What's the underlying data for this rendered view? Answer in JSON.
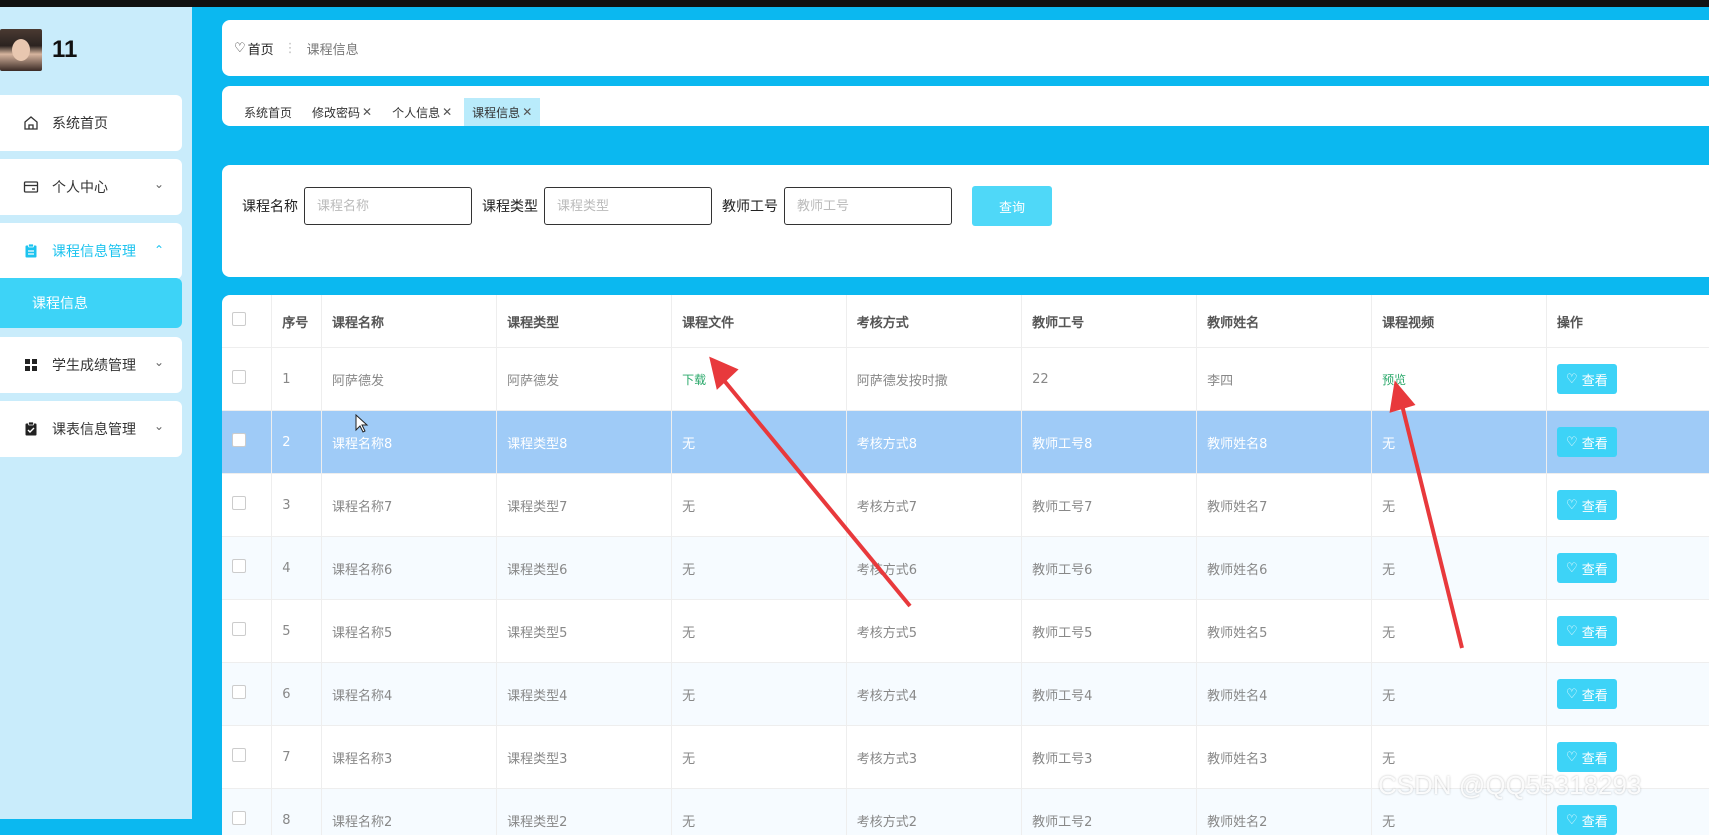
{
  "user": {
    "name": "11"
  },
  "sidebar": {
    "items": [
      {
        "label": "系统首页",
        "icon": "home-icon"
      },
      {
        "label": "个人中心",
        "icon": "card-icon"
      },
      {
        "label": "课程信息管理",
        "icon": "clipboard-icon"
      },
      {
        "label": "学生成绩管理",
        "icon": "grid-icon"
      },
      {
        "label": "课表信息管理",
        "icon": "checklist-icon"
      }
    ],
    "submenu_active": "课程信息"
  },
  "breadcrumb": {
    "home": "首页",
    "current": "课程信息"
  },
  "tabs": [
    {
      "label": "系统首页"
    },
    {
      "label": "修改密码"
    },
    {
      "label": "个人信息"
    },
    {
      "label": "课程信息"
    }
  ],
  "search": {
    "course_name_label": "课程名称",
    "course_name_placeholder": "课程名称",
    "course_type_label": "课程类型",
    "course_type_placeholder": "课程类型",
    "teacher_id_label": "教师工号",
    "teacher_id_placeholder": "教师工号",
    "query_label": "查询"
  },
  "table": {
    "headers": [
      "序号",
      "课程名称",
      "课程类型",
      "课程文件",
      "考核方式",
      "教师工号",
      "教师姓名",
      "课程视频",
      "操作"
    ],
    "view_label": "查看",
    "rows": [
      [
        "1",
        "阿萨德发",
        "阿萨德发",
        "下载",
        "阿萨德发按时撒",
        "22",
        "李四",
        "预览"
      ],
      [
        "2",
        "课程名称8",
        "课程类型8",
        "无",
        "考核方式8",
        "教师工号8",
        "教师姓名8",
        "无"
      ],
      [
        "3",
        "课程名称7",
        "课程类型7",
        "无",
        "考核方式7",
        "教师工号7",
        "教师姓名7",
        "无"
      ],
      [
        "4",
        "课程名称6",
        "课程类型6",
        "无",
        "考核方式6",
        "教师工号6",
        "教师姓名6",
        "无"
      ],
      [
        "5",
        "课程名称5",
        "课程类型5",
        "无",
        "考核方式5",
        "教师工号5",
        "教师姓名5",
        "无"
      ],
      [
        "6",
        "课程名称4",
        "课程类型4",
        "无",
        "考核方式4",
        "教师工号4",
        "教师姓名4",
        "无"
      ],
      [
        "7",
        "课程名称3",
        "课程类型3",
        "无",
        "考核方式3",
        "教师工号3",
        "教师姓名3",
        "无"
      ],
      [
        "8",
        "课程名称2",
        "课程类型2",
        "无",
        "考核方式2",
        "教师工号2",
        "教师姓名2",
        "无"
      ]
    ]
  },
  "watermark": "CSDN @QQ55318293",
  "colors": {
    "accent": "#3dd3f7",
    "selected_row": "#9fcbf7",
    "link": "#2aa86a",
    "annotation_arrow": "#e8393c"
  }
}
